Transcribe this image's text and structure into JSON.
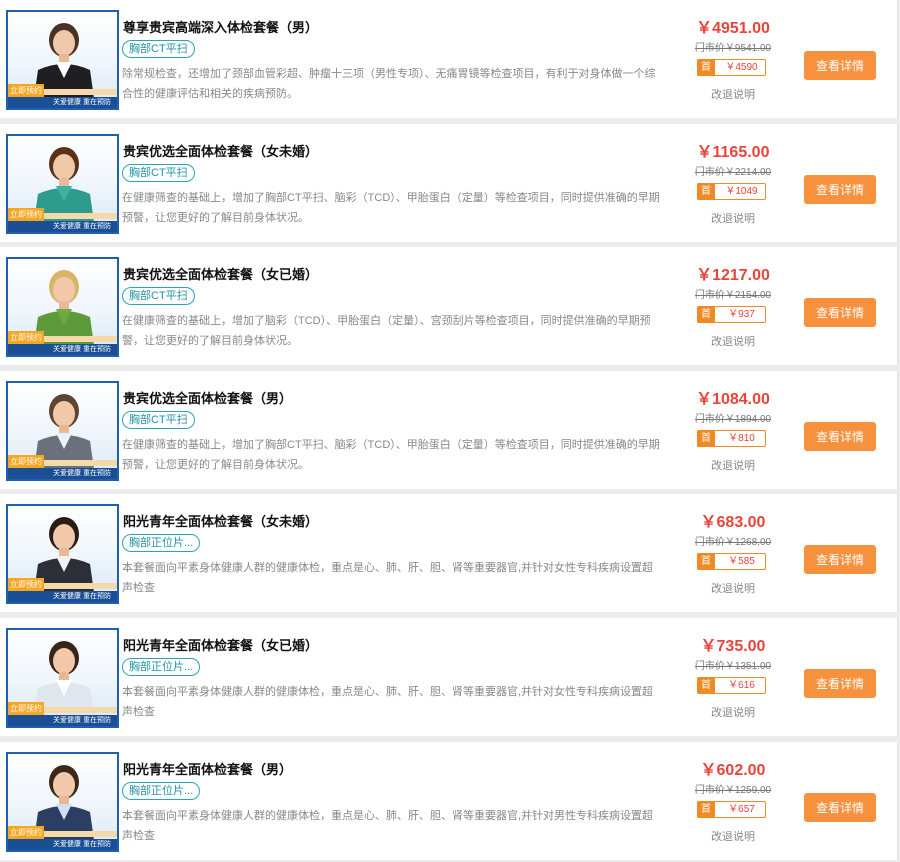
{
  "colors": {
    "accent": "#f7913d",
    "price": "#e8443a",
    "tag": "#2aa3b8",
    "frame": "#1f5fb0"
  },
  "thumb": {
    "badge": "立即预约",
    "bar": "关爱健康 重在预防"
  },
  "packages": [
    {
      "title": "尊享贵宾高端深入体检套餐（男）",
      "tag": "胸部CT平扫",
      "desc": "除常规检查，还增加了颈部血管彩超、肿瘤十三项（男性专项）、无痛胃镜等检查项目，有利于对身体做一个综合性的健康评估和相关的疾病预防。",
      "price": "￥4951.00",
      "market_price": "门市价￥9541.00",
      "first_icon": "首",
      "first_price": "￥4590",
      "refund": "改退说明",
      "button": "查看详情",
      "avatar": "man-suit-icon"
    },
    {
      "title": "贵宾优选全面体检套餐（女未婚）",
      "tag": "胸部CT平扫",
      "desc": "在健康筛查的基础上，增加了胸部CT平扫、脑彩（TCD）、甲胎蛋白（定量）等检查项目，同时提供准确的早期预警，让您更好的了解目前身体状况。",
      "price": "￥1165.00",
      "market_price": "门市价￥2214.00",
      "first_icon": "首",
      "first_price": "￥1049",
      "refund": "改退说明",
      "button": "查看详情",
      "avatar": "woman-icon"
    },
    {
      "title": "贵宾优选全面体检套餐（女已婚）",
      "tag": "胸部CT平扫",
      "desc": "在健康筛查的基础上，增加了脑彩（TCD）、甲胎蛋白（定量）、宫颈刮片等检查项目，同时提供准确的早期预警，让您更好的了解目前身体状况。",
      "price": "￥1217.00",
      "market_price": "门市价￥2154.00",
      "first_icon": "首",
      "first_price": "￥937",
      "refund": "改退说明",
      "button": "查看详情",
      "avatar": "woman-green-icon"
    },
    {
      "title": "贵宾优选全面体检套餐（男）",
      "tag": "胸部CT平扫",
      "desc": "在健康筛查的基础上，增加了胸部CT平扫、脑彩（TCD）、甲胎蛋白（定量）等检查项目，同时提供准确的早期预警，让您更好的了解目前身体状况。",
      "price": "￥1084.00",
      "market_price": "门市价￥1894.00",
      "first_icon": "首",
      "first_price": "￥810",
      "refund": "改退说明",
      "button": "查看详情",
      "avatar": "man-grey-suit-icon"
    },
    {
      "title": "阳光青年全面体检套餐（女未婚）",
      "tag": "胸部正位片...",
      "desc": "本套餐面向平素身体健康人群的健康体检，重点是心、肺、肝、胆、肾等重要器官,并针对女性专科疾病设置超声检查",
      "price": "￥683.00",
      "market_price": "门市价￥1268.00",
      "first_icon": "首",
      "first_price": "￥585",
      "refund": "改退说明",
      "button": "查看详情",
      "avatar": "woman-glasses-icon"
    },
    {
      "title": "阳光青年全面体检套餐（女已婚）",
      "tag": "胸部正位片...",
      "desc": "本套餐面向平素身体健康人群的健康体检，重点是心、肺、肝、胆、肾等重要器官,并针对女性专科疾病设置超声检查",
      "price": "￥735.00",
      "market_price": "门市价￥1351.00",
      "first_icon": "首",
      "first_price": "￥616",
      "refund": "改退说明",
      "button": "查看详情",
      "avatar": "woman-smile-icon"
    },
    {
      "title": "阳光青年全面体检套餐（男）",
      "tag": "胸部正位片...",
      "desc": "本套餐面向平素身体健康人群的健康体检，重点是心、肺、肝、胆、肾等重要器官,并针对男性专科疾病设置超声检查",
      "price": "￥602.00",
      "market_price": "门市价￥1259.00",
      "first_icon": "首",
      "first_price": "￥657",
      "refund": "改退说明",
      "button": "查看详情",
      "avatar": "man-blue-suit-icon"
    }
  ]
}
